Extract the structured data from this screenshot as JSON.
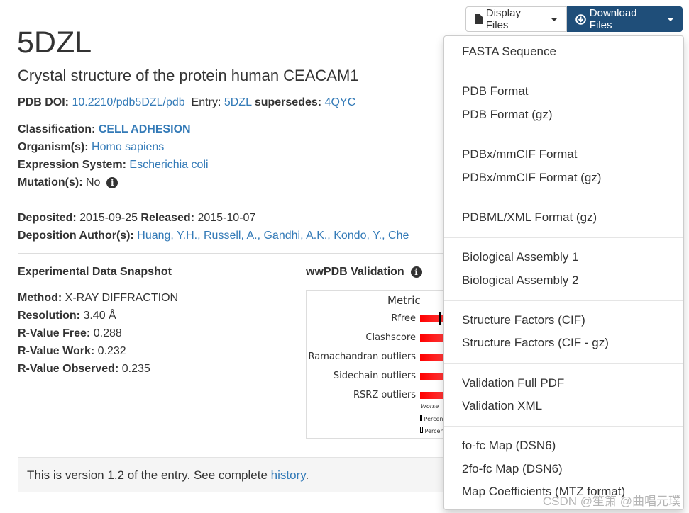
{
  "header": {
    "title": "5DZL",
    "subtitle": "Crystal structure of the protein human CEACAM1"
  },
  "doi": {
    "label": "PDB DOI:",
    "value": "10.2210/pdb5DZL/pdb",
    "entry_label": "Entry:",
    "entry": "5DZL",
    "supersedes_label": "supersedes:",
    "supersedes": "4QYC"
  },
  "info": {
    "classification_label": "Classification:",
    "classification": "CELL ADHESION",
    "organism_label": "Organism(s):",
    "organism": "Homo sapiens",
    "expression_label": "Expression System:",
    "expression": "Escherichia coli",
    "mutation_label": "Mutation(s):",
    "mutation": "No"
  },
  "dates": {
    "deposited_label": "Deposited:",
    "deposited": "2015-09-25",
    "released_label": "Released:",
    "released": "2015-10-07",
    "authors_label": "Deposition Author(s):",
    "authors": [
      "Huang, Y.H.,",
      "Russell, A.,",
      "Gandhi, A.K.,",
      "Kondo, Y.,",
      "Che"
    ]
  },
  "snapshot": {
    "title": "Experimental Data Snapshot",
    "method_label": "Method:",
    "method": "X-RAY DIFFRACTION",
    "resolution_label": "Resolution:",
    "resolution": "3.40 Å",
    "rfree_label": "R-Value Free:",
    "rfree": "0.288",
    "rwork_label": "R-Value Work:",
    "rwork": "0.232",
    "robs_label": "R-Value Observed:",
    "robs": "0.235"
  },
  "validation": {
    "title": "wwPDB Validation",
    "metric_header": "Metric",
    "metrics": [
      "Rfree",
      "Clashscore",
      "Ramachandran outliers",
      "Sidechain outliers",
      "RSRZ outliers"
    ],
    "worse": "Worse",
    "legend1": "Percen",
    "legend2": "Percen"
  },
  "version": {
    "text": "This is version 1.2 of the entry. See complete ",
    "link": "history",
    "end": "."
  },
  "toolbar": {
    "display": "Display Files",
    "download": "Download Files"
  },
  "menu": [
    "FASTA Sequence",
    "PDB Format",
    "PDB Format (gz)",
    "PDBx/mmCIF Format",
    "PDBx/mmCIF Format (gz)",
    "PDBML/XML Format (gz)",
    "Biological Assembly 1",
    "Biological Assembly 2",
    "Structure Factors (CIF)",
    "Structure Factors (CIF - gz)",
    "Validation Full PDF",
    "Validation XML",
    "fo-fc Map (DSN6)",
    "2fo-fc Map (DSN6)",
    "Map Coefficients (MTZ format)"
  ],
  "watermark": "CSDN @笙箫 @曲唱元璞"
}
